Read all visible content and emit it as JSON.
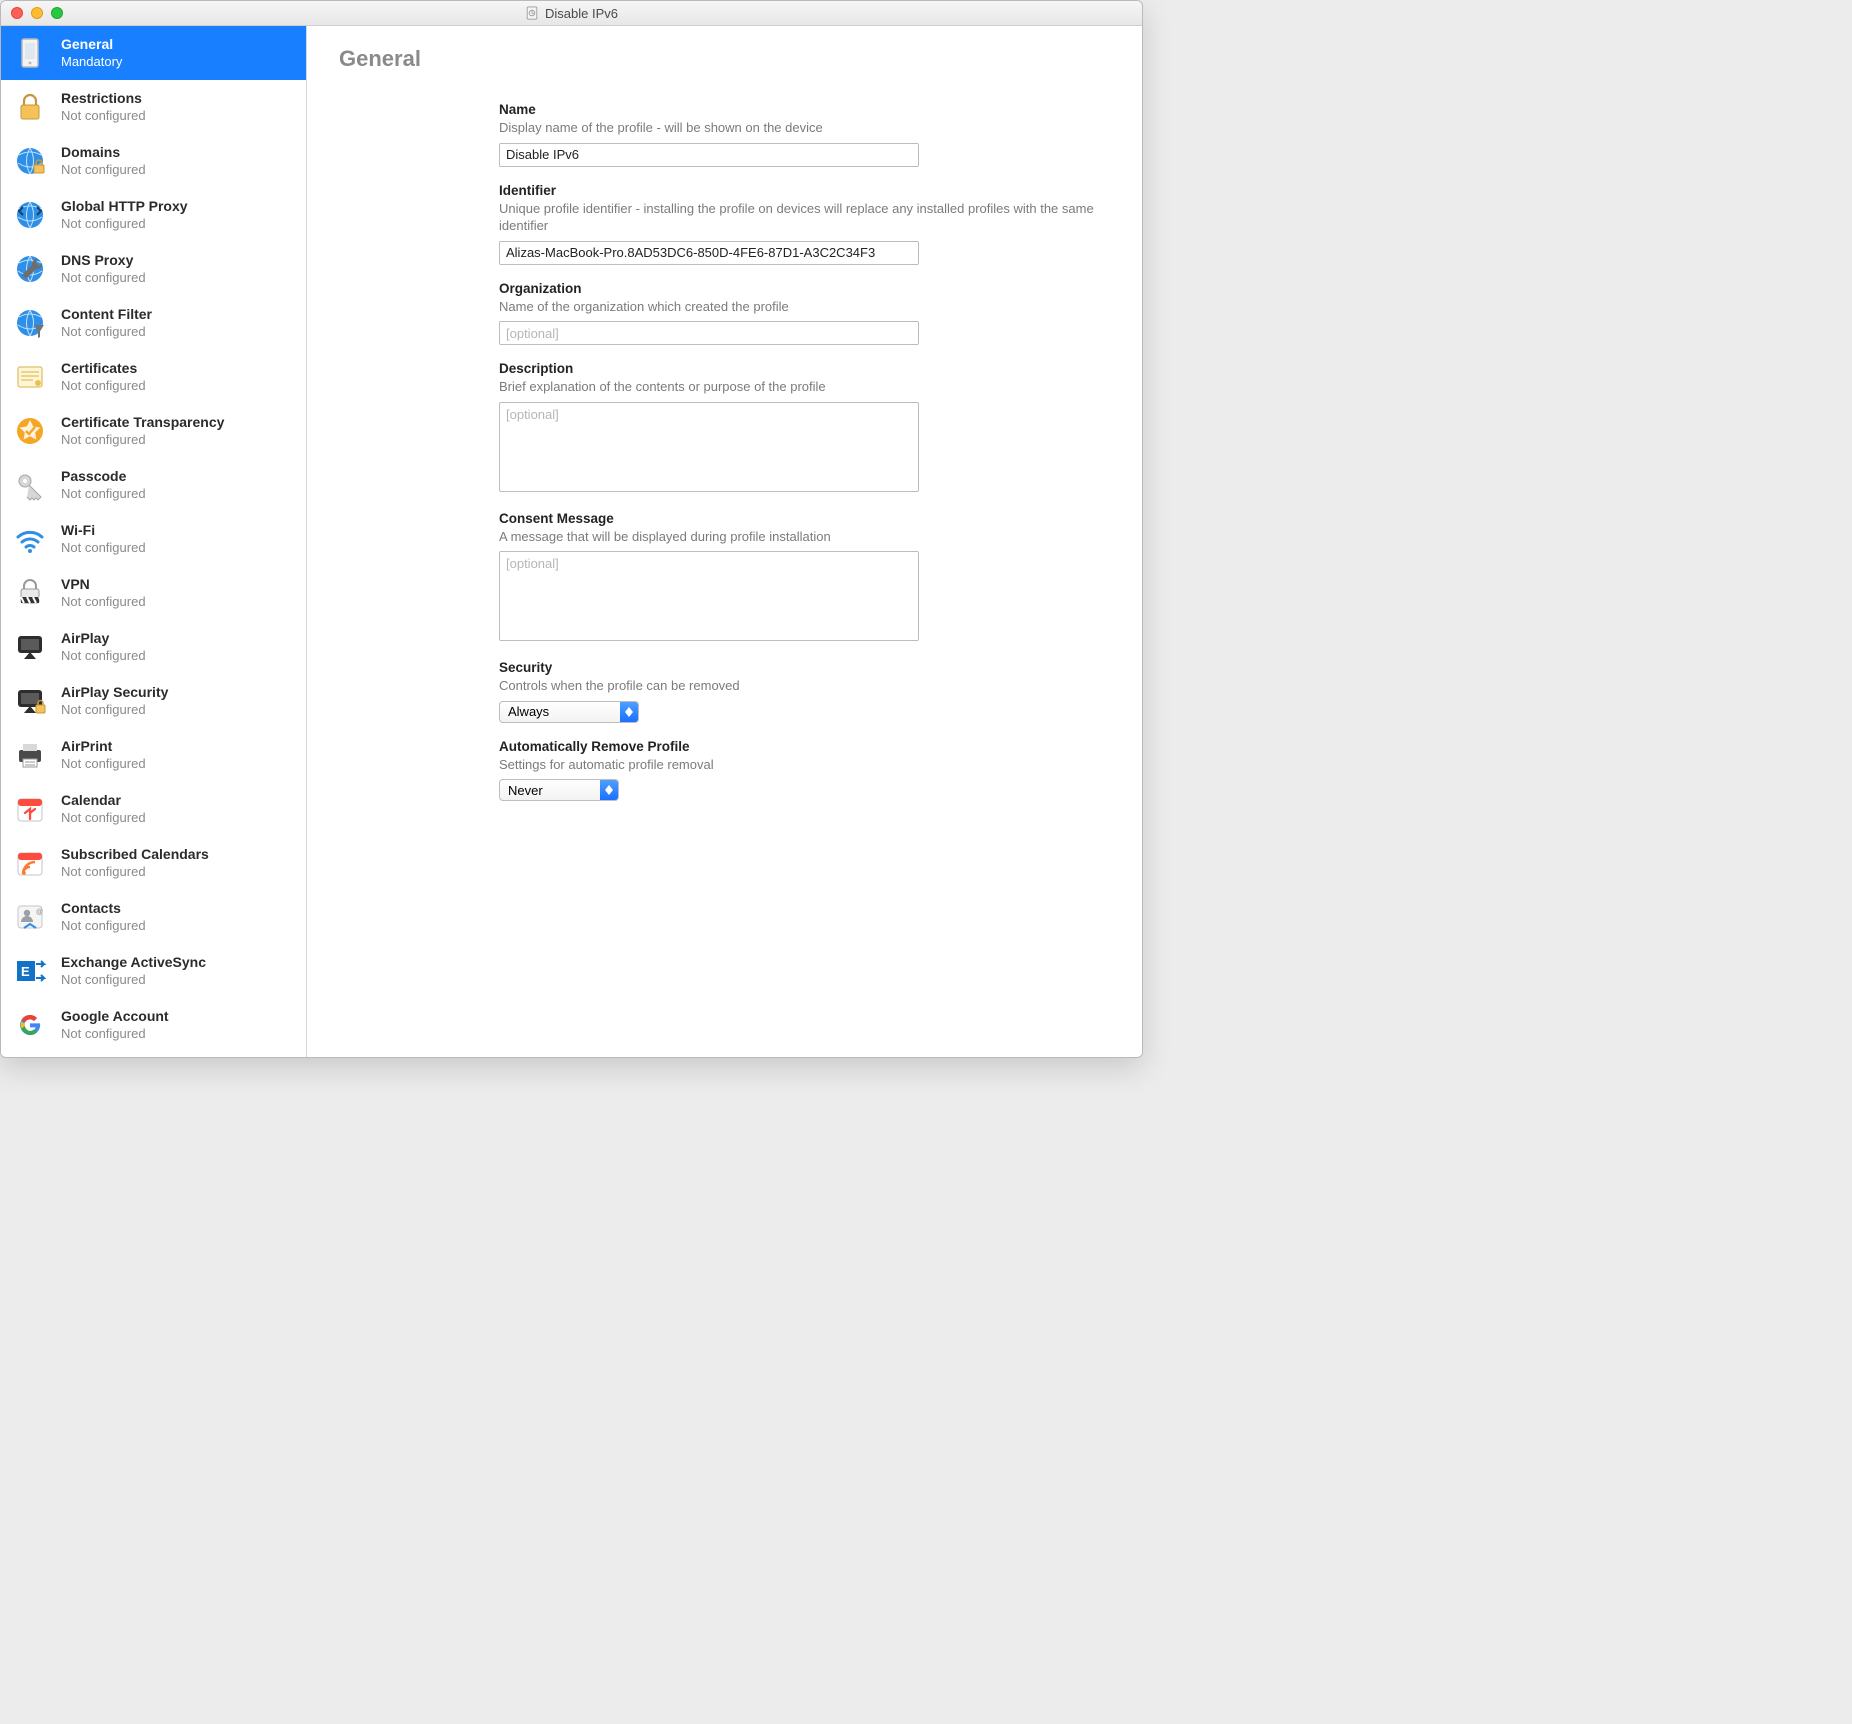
{
  "window": {
    "title": "Disable IPv6"
  },
  "sidebar": {
    "items": [
      {
        "id": "general",
        "label": "General",
        "sub": "Mandatory",
        "selected": true
      },
      {
        "id": "restrictions",
        "label": "Restrictions",
        "sub": "Not configured"
      },
      {
        "id": "domains",
        "label": "Domains",
        "sub": "Not configured"
      },
      {
        "id": "http-proxy",
        "label": "Global HTTP Proxy",
        "sub": "Not configured"
      },
      {
        "id": "dns-proxy",
        "label": "DNS Proxy",
        "sub": "Not configured"
      },
      {
        "id": "content-filter",
        "label": "Content Filter",
        "sub": "Not configured"
      },
      {
        "id": "certificates",
        "label": "Certificates",
        "sub": "Not configured"
      },
      {
        "id": "cert-transparency",
        "label": "Certificate Transparency",
        "sub": "Not configured"
      },
      {
        "id": "passcode",
        "label": "Passcode",
        "sub": "Not configured"
      },
      {
        "id": "wifi",
        "label": "Wi-Fi",
        "sub": "Not configured"
      },
      {
        "id": "vpn",
        "label": "VPN",
        "sub": "Not configured"
      },
      {
        "id": "airplay",
        "label": "AirPlay",
        "sub": "Not configured"
      },
      {
        "id": "airplay-security",
        "label": "AirPlay Security",
        "sub": "Not configured"
      },
      {
        "id": "airprint",
        "label": "AirPrint",
        "sub": "Not configured"
      },
      {
        "id": "calendar",
        "label": "Calendar",
        "sub": "Not configured"
      },
      {
        "id": "subscribed-calendars",
        "label": "Subscribed Calendars",
        "sub": "Not configured"
      },
      {
        "id": "contacts",
        "label": "Contacts",
        "sub": "Not configured"
      },
      {
        "id": "exchange-activesync",
        "label": "Exchange ActiveSync",
        "sub": "Not configured"
      },
      {
        "id": "google-account",
        "label": "Google Account",
        "sub": "Not configured"
      }
    ]
  },
  "main": {
    "heading": "General",
    "fields": {
      "name": {
        "label": "Name",
        "desc": "Display name of the profile - will be shown on the device",
        "value": "Disable IPv6"
      },
      "identifier": {
        "label": "Identifier",
        "desc": "Unique profile identifier - installing the profile on devices will replace any installed profiles with the same identifier",
        "value": "Alizas-MacBook-Pro.8AD53DC6-850D-4FE6-87D1-A3C2C34F3"
      },
      "organization": {
        "label": "Organization",
        "desc": "Name of the organization which created the profile",
        "placeholder": "[optional]",
        "value": ""
      },
      "description": {
        "label": "Description",
        "desc": "Brief explanation of the contents or purpose of the profile",
        "placeholder": "[optional]",
        "value": ""
      },
      "consent": {
        "label": "Consent Message",
        "desc": "A message that will be displayed during profile installation",
        "placeholder": "[optional]",
        "value": ""
      },
      "security": {
        "label": "Security",
        "desc": "Controls when the profile can be removed",
        "value": "Always"
      },
      "autoRemove": {
        "label": "Automatically Remove Profile",
        "desc": "Settings for automatic profile removal",
        "value": "Never"
      }
    }
  }
}
